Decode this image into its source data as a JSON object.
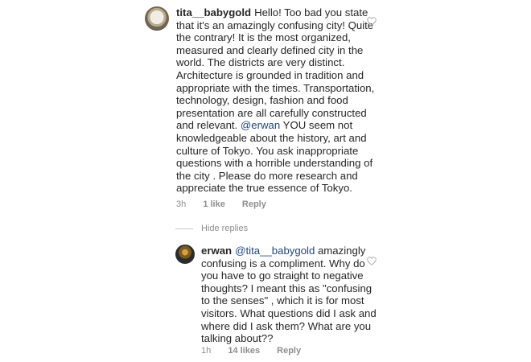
{
  "comments": [
    {
      "username": "tita__babygold",
      "text_before": "Hello! Too bad you state that it's an amazingly confusing city! Quite the contrary! It is the most organized, measured and clearly defined city in the world. The districts are very distinct. Architecture is grounded in tradition and appropriate with the times. Transportation, technology, design, fashion and food presentation are all carefully constructed and relevant. ",
      "mention": "@erwan",
      "text_after": " YOU seem not knowledgeable about the history, art and culture of Tokyo. You ask inappropriate questions with a horrible understanding of the city . Please do more research and appreciate the true essence of Tokyo.",
      "time": "3h",
      "likes": "1 like",
      "reply_label": "Reply"
    },
    {
      "username": "erwan",
      "mention": "@tita__babygold",
      "text_after": " amazingly confusing is a compliment. Why do you have to go straight to negative thoughts? I meant this as \"confusing to the senses\" , which it is for most visitors. What questions did I ask and where did I ask them? What are you talking about??",
      "time": "1h",
      "likes": "14 likes",
      "reply_label": "Reply"
    }
  ],
  "hide_replies_label": "Hide replies",
  "icons": {
    "like": "heart-outline-icon"
  },
  "colors": {
    "text": "#262626",
    "meta": "#8e8e8e",
    "mention": "#1e4778",
    "heart": "#b0b0b0"
  }
}
